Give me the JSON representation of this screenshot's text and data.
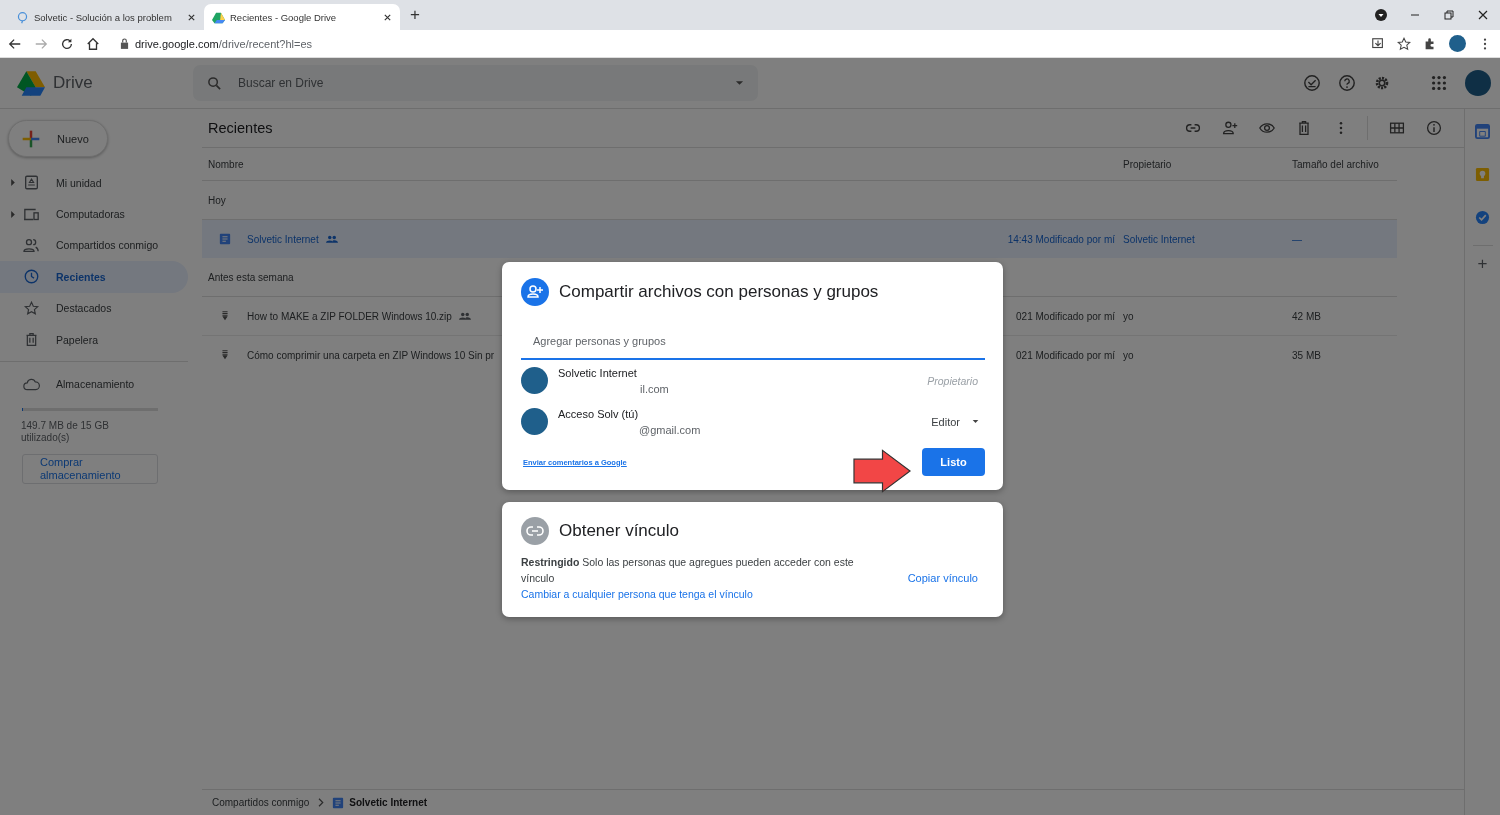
{
  "browser": {
    "tabs": [
      {
        "title": "Solvetic - Solución a los problem",
        "selected": false
      },
      {
        "title": "Recientes - Google Drive",
        "selected": true
      }
    ],
    "new_tab": "+",
    "url_host": "drive.google.com",
    "url_path": "/drive/recent?hl=es"
  },
  "header": {
    "brand": "Drive",
    "search_placeholder": "Buscar en Drive"
  },
  "sidebar": {
    "new_button": "Nuevo",
    "items": [
      {
        "label": "Mi unidad",
        "selected": false,
        "expandable": true
      },
      {
        "label": "Computadoras",
        "selected": false,
        "expandable": true
      },
      {
        "label": "Compartidos conmigo",
        "selected": false,
        "expandable": false
      },
      {
        "label": "Recientes",
        "selected": true,
        "expandable": false
      },
      {
        "label": "Destacados",
        "selected": false,
        "expandable": false
      },
      {
        "label": "Papelera",
        "selected": false,
        "expandable": false
      }
    ],
    "storage": {
      "label": "Almacenamiento",
      "level": 0.01,
      "usage": "149.7 MB de 15 GB utilizado(s)",
      "buy_button": "Comprar almacenamiento"
    }
  },
  "page_title": "Recientes",
  "table": {
    "columns": [
      "Nombre",
      "Propietario",
      "Tamaño del archivo"
    ],
    "groups": [
      {
        "label": "Hoy",
        "rows": [
          {
            "kind": "doc",
            "name": "Solvetic Internet",
            "shared": true,
            "selected": true,
            "modified": "14:43 Modificado por mí",
            "owner": "Solvetic Internet",
            "size": "—"
          }
        ]
      },
      {
        "label": "Antes esta semana",
        "rows": [
          {
            "kind": "zip",
            "name": "How to MAKE a ZIP FOLDER Windows 10.zip",
            "shared": true,
            "selected": false,
            "modified": "021 Modificado por mí",
            "owner": "yo",
            "size": "42 MB"
          },
          {
            "kind": "zip",
            "name": "Cómo comprimir una carpeta en ZIP Windows 10 Sin pr",
            "shared": false,
            "selected": false,
            "modified": "021 Modificado por mí",
            "owner": "yo",
            "size": "35 MB"
          }
        ]
      }
    ]
  },
  "breadcrumb": [
    {
      "label": "Compartidos conmigo",
      "kind": "folder"
    },
    {
      "label": "Solvetic Internet",
      "kind": "doc"
    }
  ],
  "side_panel": {
    "add": "+"
  },
  "share_dialog": {
    "title": "Compartir archivos con personas y grupos",
    "input_placeholder": "Agregar personas y grupos",
    "people": [
      {
        "name": "Solvetic Internet",
        "email": "il.com",
        "role": "Propietario",
        "kind": "owner"
      },
      {
        "name": "Acceso Solv (tú)",
        "email": "@gmail.com",
        "role": "Editor",
        "kind": "editor"
      }
    ],
    "feedback_link": "Enviar comentarios a Google",
    "done_button": "Listo"
  },
  "link_dialog": {
    "title": "Obtener vínculo",
    "description": "**Restringido** Solo las personas que agregues pueden acceder con este vínculo",
    "change_link": "Cambiar a cualquier persona que tenga el vínculo",
    "copy_link": "Copiar vínculo"
  }
}
